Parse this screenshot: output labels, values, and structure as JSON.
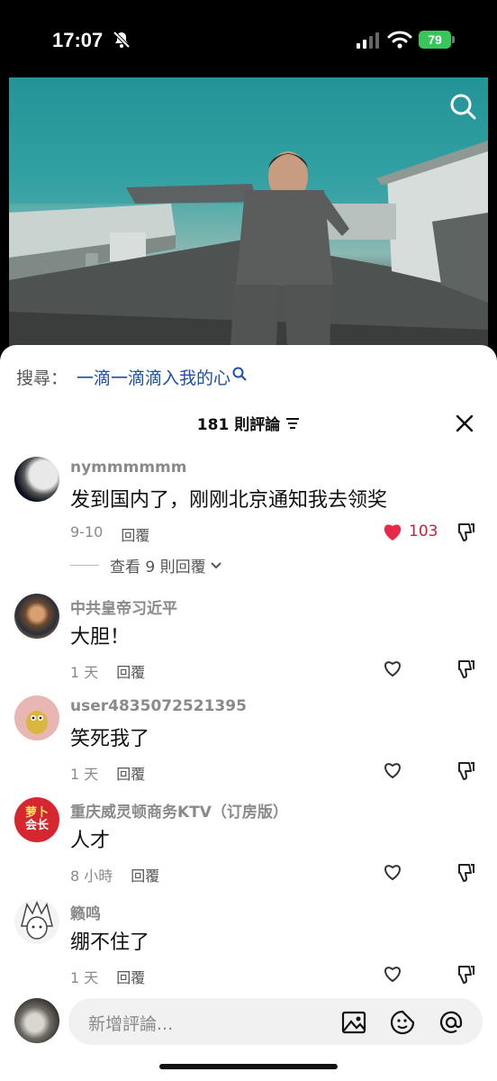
{
  "status_bar": {
    "time": "17:07",
    "battery": "79"
  },
  "search": {
    "label": "搜尋：",
    "term": "一滴一滴滴入我的心"
  },
  "header": {
    "comment_count": "181 則評論"
  },
  "comments": [
    {
      "username": "nymmmmmm",
      "text": "发到国内了，刚刚北京通知我去领奖",
      "time": "9-10",
      "reply": "回覆",
      "likes": "103",
      "liked": true,
      "view_replies": "查看 9 則回覆"
    },
    {
      "username": "中共皇帝习近平",
      "text": "大胆！",
      "time": "1 天",
      "reply": "回覆",
      "likes": "",
      "liked": false
    },
    {
      "username": "user4835072521395",
      "text": "笑死我了",
      "time": "1 天",
      "reply": "回覆",
      "likes": "",
      "liked": false
    },
    {
      "username": "重庆威灵顿商务KTV（订房版）",
      "text": "人才",
      "time": "8 小時",
      "reply": "回覆",
      "likes": "",
      "liked": false,
      "avatar_text": [
        "萝卜",
        "会长"
      ]
    },
    {
      "username": "籁鸣",
      "text": "绷不住了",
      "time": "1 天",
      "reply": "回覆",
      "likes": "",
      "liked": false
    }
  ],
  "composer": {
    "placeholder": "新增評論..."
  },
  "colors": {
    "accent_like": "#e8294b",
    "search_term": "#1d4fa7",
    "battery": "#35c759"
  }
}
